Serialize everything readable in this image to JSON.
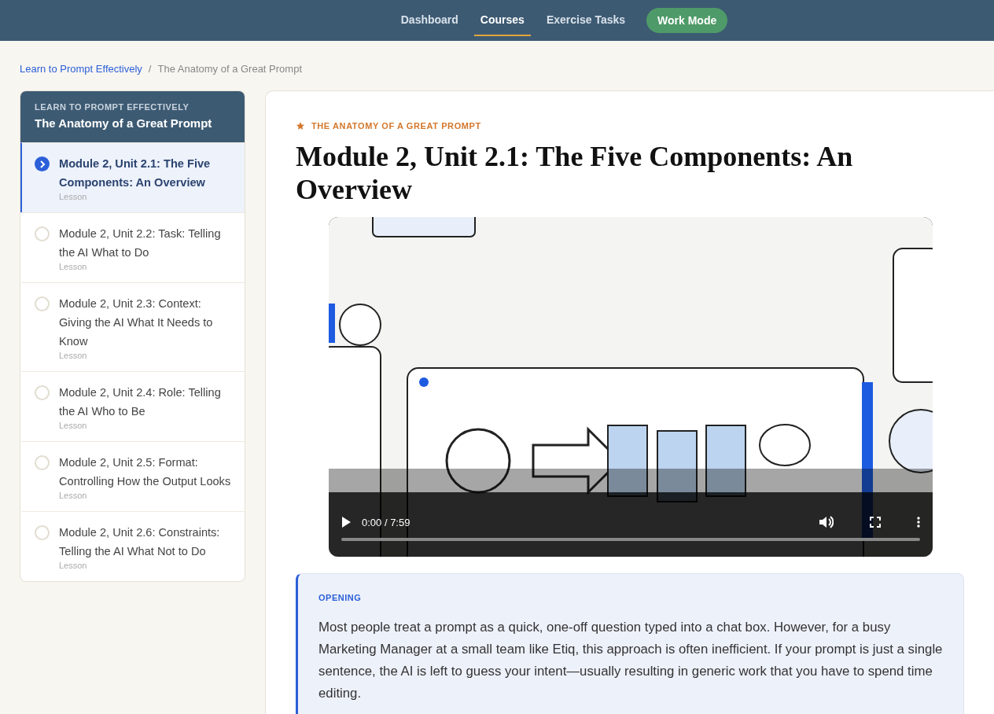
{
  "nav": {
    "items": [
      {
        "label": "Dashboard",
        "selected": false
      },
      {
        "label": "Courses",
        "selected": true
      },
      {
        "label": "Exercise Tasks",
        "selected": false
      }
    ],
    "work_mode": "Work Mode"
  },
  "breadcrumb": {
    "link": "Learn to Prompt Effectively",
    "separator": "/",
    "current": "The Anatomy of a Great Prompt"
  },
  "sidebar": {
    "course": "LEARN TO PROMPT EFFECTIVELY",
    "title": "The Anatomy of a Great Prompt",
    "lessons": [
      {
        "title": "Module 2, Unit 2.1: The Five Components: An Overview",
        "type": "Lesson",
        "selected": true
      },
      {
        "title": "Module 2, Unit 2.2: Task: Telling the AI What to Do",
        "type": "Lesson",
        "selected": false
      },
      {
        "title": "Module 2, Unit 2.3: Context: Giving the AI What It Needs to Know",
        "type": "Lesson",
        "selected": false
      },
      {
        "title": "Module 2, Unit 2.4: Role: Telling the AI Who to Be",
        "type": "Lesson",
        "selected": false
      },
      {
        "title": "Module 2, Unit 2.5: Format: Controlling How the Output Looks",
        "type": "Lesson",
        "selected": false
      },
      {
        "title": "Module 2, Unit 2.6: Constraints: Telling the AI What Not to Do",
        "type": "Lesson",
        "selected": false
      }
    ]
  },
  "content": {
    "eyebrow": "THE ANATOMY OF A GREAT PROMPT",
    "title": "Module 2, Unit 2.1: The Five Components: An Overview",
    "video": {
      "kind": "picture",
      "time": "0:00 / 7:59"
    },
    "callout": {
      "label": "OPENING",
      "text": "Most people treat a prompt as a quick, one-off question typed into a chat box. However, for a busy Marketing Manager at a small team like Etiq, this approach is often inefficient. If your prompt is just a single sentence, the AI is left to guess your intent—usually resulting in generic work that you have to spend time editing."
    }
  }
}
